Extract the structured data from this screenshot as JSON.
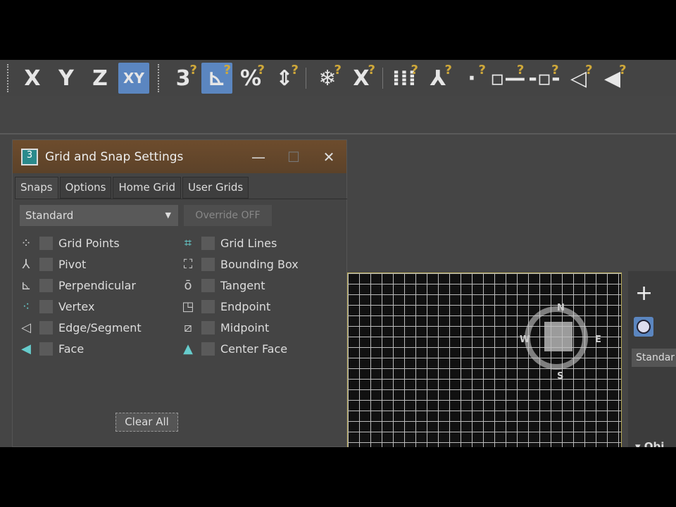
{
  "toolbar": {
    "items": [
      {
        "label": "X",
        "icon": "axis-x"
      },
      {
        "label": "Y",
        "icon": "axis-y"
      },
      {
        "label": "Z",
        "icon": "axis-z"
      },
      {
        "label": "XY",
        "icon": "axis-xy",
        "active": true
      },
      {
        "label": "3",
        "icon": "snaps-toggle"
      },
      {
        "label": "⊾",
        "icon": "angle-snap",
        "active": true
      },
      {
        "label": "%",
        "icon": "percent-snap"
      },
      {
        "label": "⇕",
        "icon": "spinner-snap"
      },
      {
        "label": "❄",
        "icon": "freeze-snap"
      },
      {
        "label": "X",
        "icon": "snap-to-axis"
      },
      {
        "label": "⁞⁞⁞",
        "icon": "grid-points-snap"
      },
      {
        "label": "⅄",
        "icon": "pivot-snap"
      },
      {
        "label": "·",
        "icon": "vertex-snap"
      },
      {
        "label": "▫—",
        "icon": "endpoint-snap"
      },
      {
        "label": "-▫-",
        "icon": "midpoint-snap"
      },
      {
        "label": "◁",
        "icon": "edge-snap"
      },
      {
        "label": "◀",
        "icon": "face-snap"
      }
    ]
  },
  "dialog": {
    "title": "Grid and Snap Settings",
    "minimize": "—",
    "maximize": "☐",
    "close": "✕",
    "tabs": [
      "Snaps",
      "Options",
      "Home Grid",
      "User Grids"
    ],
    "selected_tab": "Snaps",
    "preset": "Standard",
    "override": "Override OFF",
    "left": [
      {
        "label": "Grid Points",
        "icon": "⁘"
      },
      {
        "label": "Pivot",
        "icon": "⅄"
      },
      {
        "label": "Perpendicular",
        "icon": "⊾"
      },
      {
        "label": "Vertex",
        "icon": "⁖"
      },
      {
        "label": "Edge/Segment",
        "icon": "◁"
      },
      {
        "label": "Face",
        "icon": "◀"
      }
    ],
    "right": [
      {
        "label": "Grid Lines",
        "icon": "⌗"
      },
      {
        "label": "Bounding Box",
        "icon": "⛶"
      },
      {
        "label": "Tangent",
        "icon": "ō"
      },
      {
        "label": "Endpoint",
        "icon": "◳"
      },
      {
        "label": "Midpoint",
        "icon": "⧄"
      },
      {
        "label": "Center Face",
        "icon": "▲"
      }
    ],
    "clear_all": "Clear All"
  },
  "viewcube": {
    "n": "N",
    "s": "S",
    "e": "E",
    "w": "W"
  },
  "command_panel": {
    "add": "+",
    "dropdown": "Standar",
    "rollout": "▾ Obj"
  }
}
